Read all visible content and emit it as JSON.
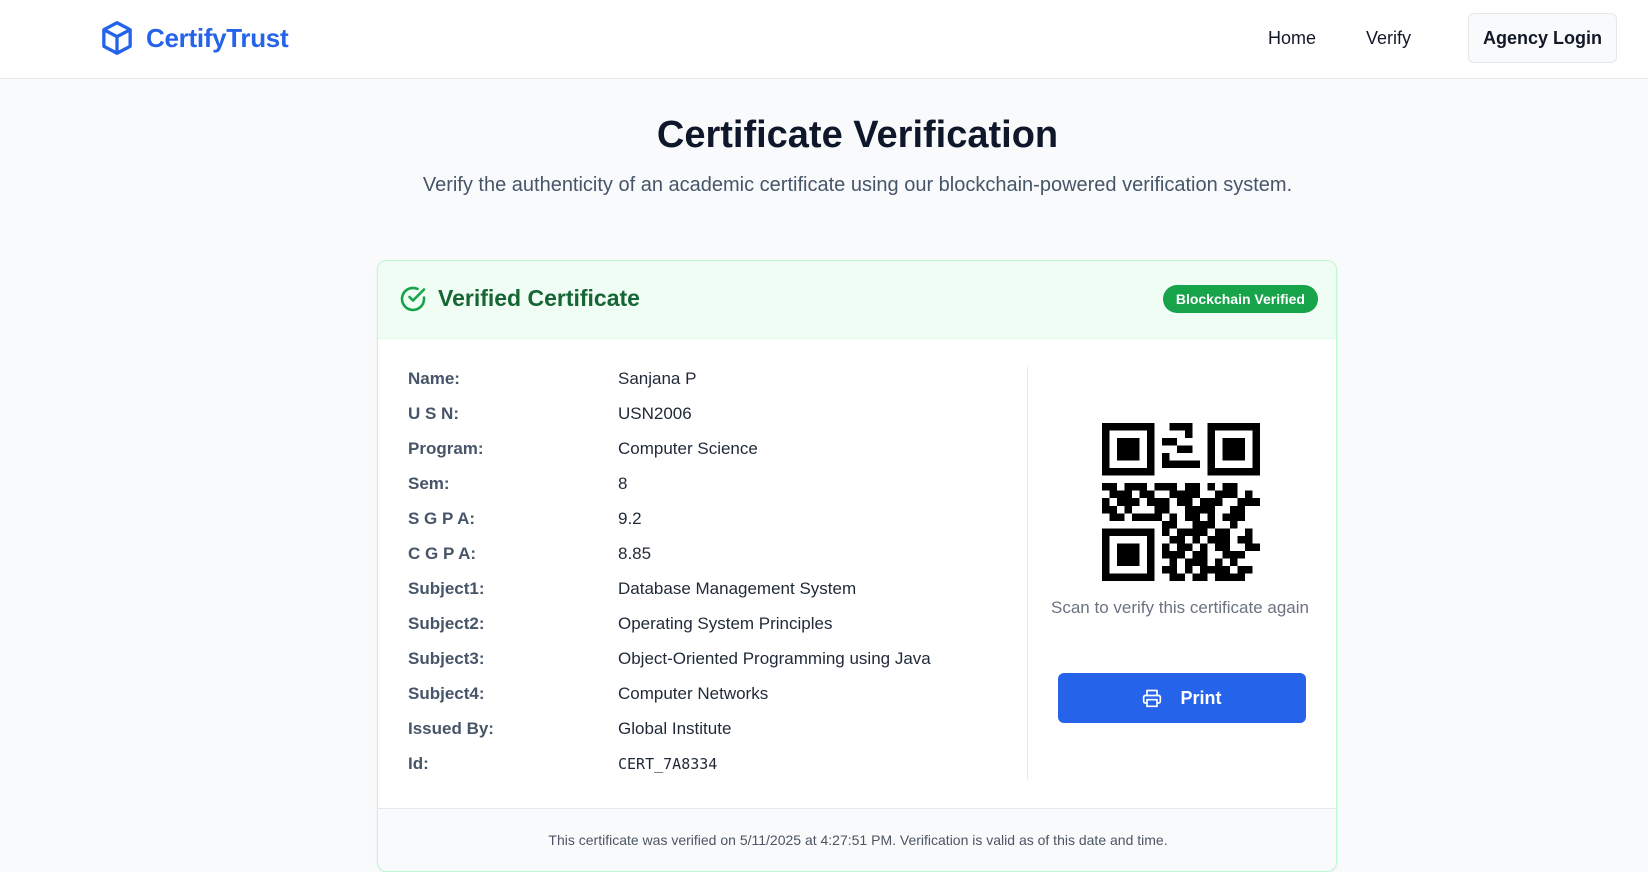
{
  "nav": {
    "brand": "CertifyTrust",
    "brand_icon": "box-cube-icon",
    "links": [
      {
        "label": "Home"
      },
      {
        "label": "Verify"
      }
    ],
    "login_label": "Agency Login"
  },
  "page": {
    "title": "Certificate Verification",
    "subtitle": "Verify the authenticity of an academic certificate using our blockchain-powered verification system."
  },
  "card": {
    "title": "Verified Certificate",
    "title_icon": "check-circle-icon",
    "badge": "Blockchain Verified",
    "fields": [
      {
        "label": "Name:",
        "value": "Sanjana P"
      },
      {
        "label": "U S N:",
        "value": "USN2006"
      },
      {
        "label": "Program:",
        "value": "Computer Science"
      },
      {
        "label": "Sem:",
        "value": "8"
      },
      {
        "label": "S G P A:",
        "value": "9.2"
      },
      {
        "label": "C G P A:",
        "value": "8.85"
      },
      {
        "label": "Subject1:",
        "value": "Database Management System"
      },
      {
        "label": "Subject2:",
        "value": "Operating System Principles"
      },
      {
        "label": "Subject3:",
        "value": "Object-Oriented Programming using Java"
      },
      {
        "label": "Subject4:",
        "value": "Computer Networks"
      },
      {
        "label": "Issued By:",
        "value": "Global Institute"
      },
      {
        "label": "Id:",
        "value": "CERT_7A8334"
      }
    ],
    "qr_caption": "Scan to verify this certificate again",
    "print_label": "Print",
    "print_icon": "printer-icon",
    "footer": "This certificate was verified on 5/11/2025 at 4:27:51 PM. Verification is valid as of this date and time."
  },
  "colors": {
    "brand": "#2563eb",
    "success": "#16a34a",
    "success_dark": "#166534",
    "header_bg": "#f0fdf4"
  }
}
